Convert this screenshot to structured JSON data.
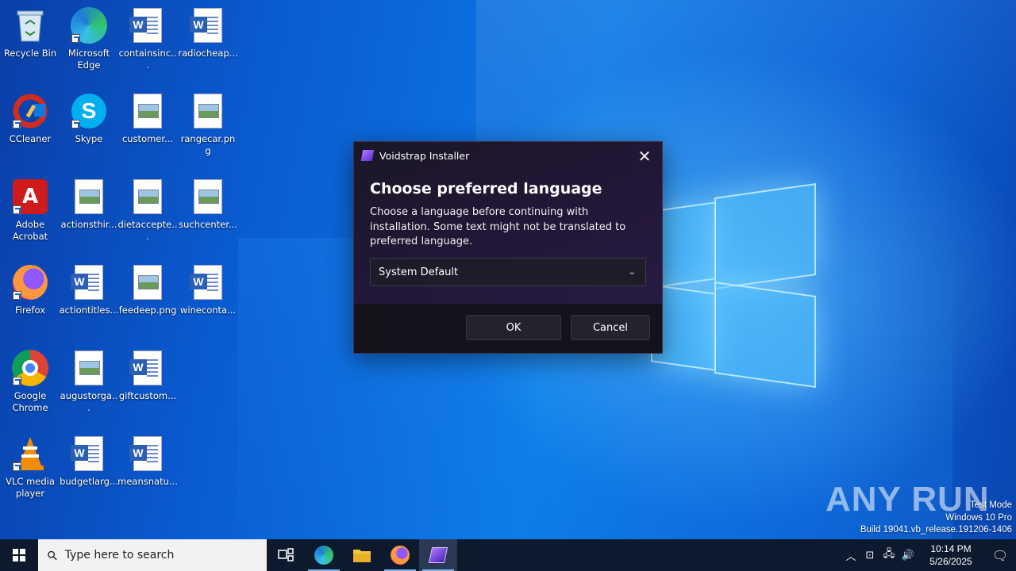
{
  "desktop": {
    "icons": [
      {
        "label": "Recycle Bin",
        "icon": "recycle-bin-icon"
      },
      {
        "label": "Microsoft Edge",
        "icon": "edge-icon"
      },
      {
        "label": "containsinc...",
        "icon": "word-doc-icon"
      },
      {
        "label": "radiocheap...",
        "icon": "word-doc-icon"
      },
      {
        "label": "CCleaner",
        "icon": "ccleaner-icon"
      },
      {
        "label": "Skype",
        "icon": "skype-icon"
      },
      {
        "label": "customer...",
        "icon": "image-file-icon"
      },
      {
        "label": "rangecar.png",
        "icon": "image-file-icon"
      },
      {
        "label": "Adobe Acrobat",
        "icon": "acrobat-icon"
      },
      {
        "label": "actionsthir...",
        "icon": "image-file-icon"
      },
      {
        "label": "dietaccepte...",
        "icon": "image-file-icon"
      },
      {
        "label": "suchcenter...",
        "icon": "image-file-icon"
      },
      {
        "label": "Firefox",
        "icon": "firefox-icon"
      },
      {
        "label": "actiontitles...",
        "icon": "word-doc-icon"
      },
      {
        "label": "feedeep.png",
        "icon": "image-file-icon"
      },
      {
        "label": "wineconta...",
        "icon": "word-doc-icon"
      },
      {
        "label": "Google Chrome",
        "icon": "chrome-icon"
      },
      {
        "label": "augustorga...",
        "icon": "image-file-icon"
      },
      {
        "label": "giftcustom...",
        "icon": "word-doc-icon"
      },
      {
        "label": "VLC media player",
        "icon": "vlc-icon"
      },
      {
        "label": "budgetlarg...",
        "icon": "word-doc-icon"
      },
      {
        "label": "meansnatu...",
        "icon": "word-doc-icon"
      }
    ]
  },
  "dialog": {
    "window_title": "Voidstrap Installer",
    "heading": "Choose preferred language",
    "description": "Choose a language before continuing with installation. Some text might not be translated to preferred language.",
    "language_select_value": "System Default",
    "ok_label": "OK",
    "cancel_label": "Cancel",
    "close_glyph": "✕",
    "chevron_glyph": "⌄"
  },
  "watermark": {
    "brand": "ANY RUN",
    "mode": "Test Mode",
    "os": "Windows 10 Pro",
    "build": "Build 19041.vb_release.191206-1406"
  },
  "taskbar": {
    "search_placeholder": "Type here to search",
    "apps": [
      "task-view-icon",
      "edge-icon",
      "file-explorer-icon",
      "firefox-icon",
      "voidstrap-icon"
    ],
    "time": "10:14 PM",
    "date": "5/26/2025"
  },
  "colors": {
    "desktop_blue": "#0c7ae6",
    "dialog_bg": "#1b1726",
    "taskbar_bg": "#0d1a2e"
  }
}
